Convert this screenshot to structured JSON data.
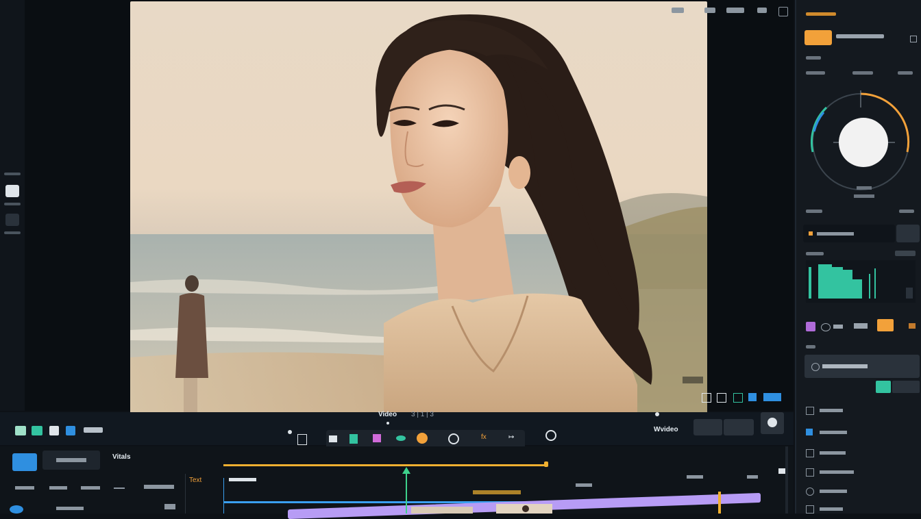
{
  "controls": {
    "view_label": "Video",
    "counter_text": "3 | 1 | 3",
    "watermark_label": "Wvideo",
    "tool_label_left": "Vitals",
    "play_tab": "▶",
    "track_label": "Text",
    "transport_text": "fx"
  },
  "right_panel": {
    "accent_orange": "#f2a13a",
    "accent_teal": "#33c3a0",
    "accent_blue": "#2f8fe0",
    "accent_purple": "#a78bfa"
  },
  "colors": {
    "timeline_yellow": "#f0b030",
    "timeline_blue": "#3aa0f0",
    "timeline_purple": "#b79cf5",
    "playhead_green": "#3ed28c"
  }
}
